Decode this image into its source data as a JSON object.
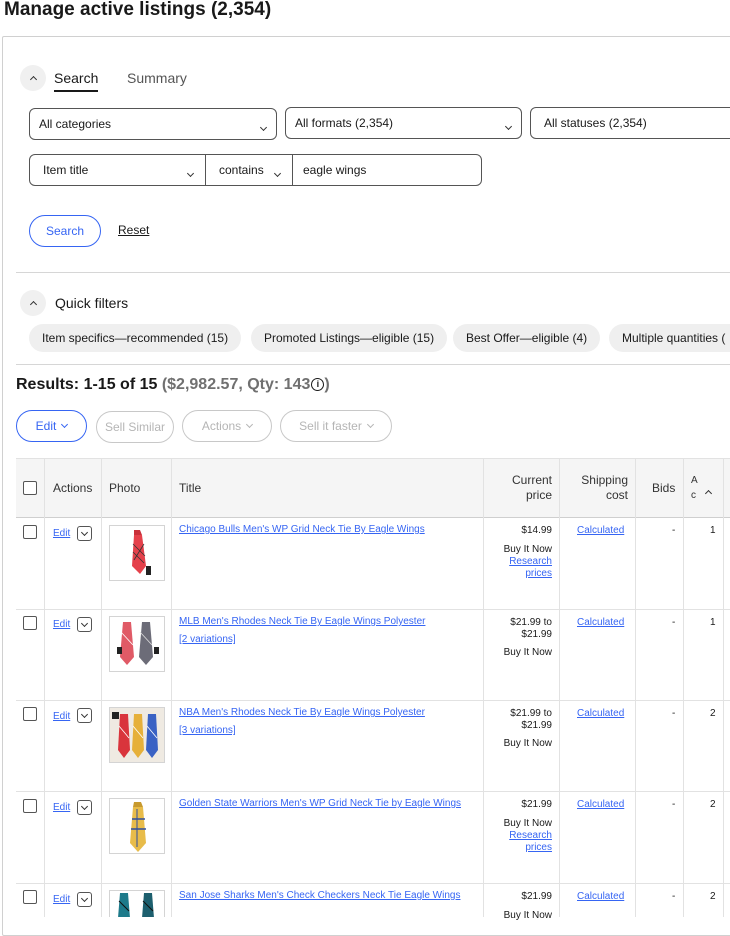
{
  "page": {
    "title": "Manage active listings (2,354)"
  },
  "search_panel": {
    "tabs": [
      "Search",
      "Summary"
    ],
    "category_select": "All categories",
    "format_select": "All formats (2,354)",
    "status_select": "All statuses (2,354)",
    "field_select": "Item title",
    "operator_select": "contains",
    "query_value": "eagle wings",
    "search_button": "Search",
    "reset_link": "Reset"
  },
  "quick_filters": {
    "title": "Quick filters",
    "chips": [
      "Item specifics—recommended (15)",
      "Promoted Listings—eligible (15)",
      "Best Offer—eligible (4)",
      "Multiple quantities ("
    ]
  },
  "results": {
    "label": "Results: 1-15 of 15 ",
    "summary": "($2,982.57, Qty: 143",
    "close_paren": ")"
  },
  "toolbar": {
    "edit": "Edit",
    "sell_similar": "Sell Similar",
    "actions": "Actions",
    "sell_faster": "Sell it faster"
  },
  "table": {
    "headers": {
      "actions": "Actions",
      "photo": "Photo",
      "title": "Title",
      "price_line1": "Current",
      "price_line2": "price",
      "ship_line1": "Shipping",
      "ship_line2": "cost",
      "bids": "Bids",
      "avail_line1": "A",
      "avail_line2": "c"
    },
    "edit_label": "Edit",
    "rows": [
      {
        "title": "Chicago Bulls Men's WP Grid Neck Tie By Eagle Wings",
        "variations": "",
        "price": "$14.99",
        "format": "Buy It Now",
        "research_1": "Research",
        "research_2": "prices",
        "shipping": "Calculated",
        "bids": "-",
        "qty": "1"
      },
      {
        "title": "MLB Men's Rhodes Neck Tie By Eagle Wings Polyester",
        "variations": "[2 variations]",
        "price": "$21.99 to",
        "price_2": "$21.99",
        "format": "Buy It Now",
        "shipping": "Calculated",
        "bids": "-",
        "qty": "1"
      },
      {
        "title": "NBA Men's Rhodes Neck Tie By Eagle Wings Polyester",
        "variations": "[3 variations]",
        "price": "$21.99 to",
        "price_2": "$21.99",
        "format": "Buy It Now",
        "shipping": "Calculated",
        "bids": "-",
        "qty": "2"
      },
      {
        "title": "Golden State Warriors Men's WP Grid Neck Tie by Eagle Wings",
        "variations": "",
        "price": "$21.99",
        "format": "Buy It Now",
        "research_1": "Research",
        "research_2": "prices",
        "shipping": "Calculated",
        "bids": "-",
        "qty": "2"
      },
      {
        "title": "San Jose Sharks Men's Check Checkers Neck Tie Eagle Wings",
        "variations": "",
        "price": "$21.99",
        "format": "Buy It Now",
        "shipping": "Calculated",
        "bids": "-",
        "qty": "2"
      }
    ]
  },
  "colors": {
    "link": "#3665f3",
    "text": "#191919",
    "muted": "#707070"
  }
}
